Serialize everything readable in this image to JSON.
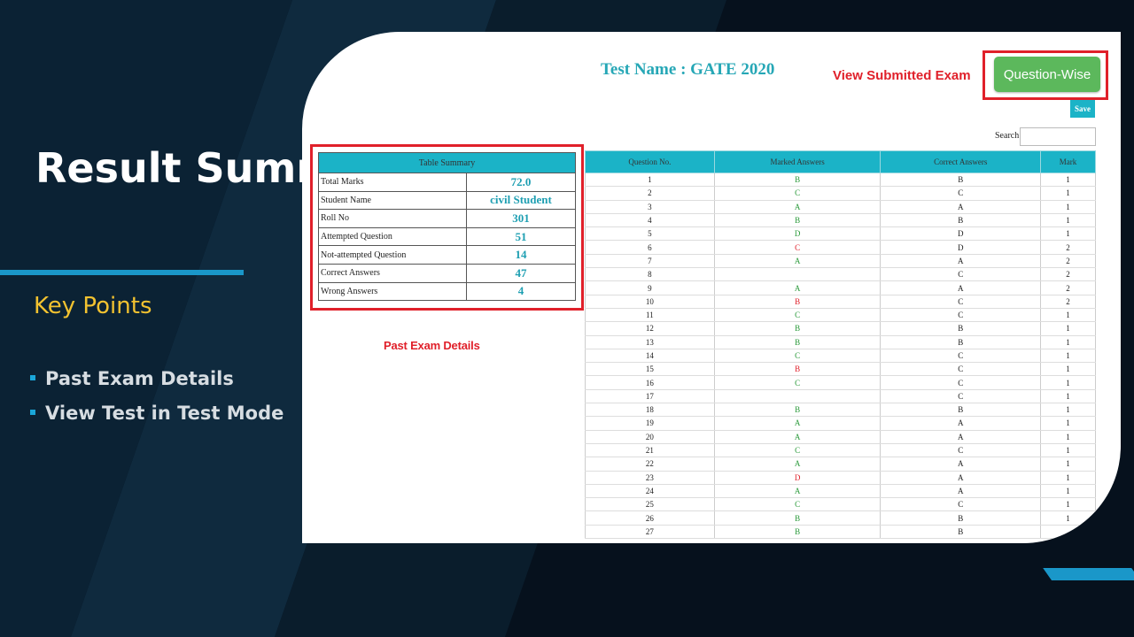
{
  "slide": {
    "title": "Result Summary",
    "subtitle": "Key Points",
    "bullets": [
      "Past Exam Details",
      "View Test in Test Mode"
    ]
  },
  "colors": {
    "background": "#06111d",
    "accent_blue": "#1a97c9",
    "subtitle_yellow": "#f2c230",
    "table_header": "#1bb3c7",
    "annotation_red": "#e0202a",
    "button_green": "#5cb85c"
  },
  "screenshot": {
    "test_name": "Test Name : GATE 2020",
    "annotation_view_submitted": "View Submitted Exam",
    "annotation_past_exam": "Past Exam Details",
    "question_wise_button": "Question-Wise",
    "save_button": "Save",
    "search_label": "Search:",
    "search_value": "",
    "summary_table": {
      "header": "Table Summary",
      "rows": [
        {
          "label": "Total Marks",
          "value": "72.0"
        },
        {
          "label": "Student Name",
          "value": "civil Student"
        },
        {
          "label": "Roll No",
          "value": "301"
        },
        {
          "label": "Attempted Question",
          "value": "51"
        },
        {
          "label": "Not-attempted Question",
          "value": "14"
        },
        {
          "label": "Correct Answers",
          "value": "47"
        },
        {
          "label": "Wrong Answers",
          "value": "4"
        }
      ]
    },
    "answers_table": {
      "columns": [
        "Question No.",
        "Marked Answers",
        "Correct Answers",
        "Mark"
      ],
      "rows": [
        {
          "q": "1",
          "marked": "B",
          "correct": "B",
          "mark": "1",
          "status": "correct"
        },
        {
          "q": "2",
          "marked": "C",
          "correct": "C",
          "mark": "1",
          "status": "correct"
        },
        {
          "q": "3",
          "marked": "A",
          "correct": "A",
          "mark": "1",
          "status": "correct"
        },
        {
          "q": "4",
          "marked": "B",
          "correct": "B",
          "mark": "1",
          "status": "correct"
        },
        {
          "q": "5",
          "marked": "D",
          "correct": "D",
          "mark": "1",
          "status": "correct"
        },
        {
          "q": "6",
          "marked": "C",
          "correct": "D",
          "mark": "2",
          "status": "wrong"
        },
        {
          "q": "7",
          "marked": "A",
          "correct": "A",
          "mark": "2",
          "status": "correct"
        },
        {
          "q": "8",
          "marked": "",
          "correct": "C",
          "mark": "2",
          "status": "none"
        },
        {
          "q": "9",
          "marked": "A",
          "correct": "A",
          "mark": "2",
          "status": "correct"
        },
        {
          "q": "10",
          "marked": "B",
          "correct": "C",
          "mark": "2",
          "status": "wrong"
        },
        {
          "q": "11",
          "marked": "C",
          "correct": "C",
          "mark": "1",
          "status": "correct"
        },
        {
          "q": "12",
          "marked": "B",
          "correct": "B",
          "mark": "1",
          "status": "correct"
        },
        {
          "q": "13",
          "marked": "B",
          "correct": "B",
          "mark": "1",
          "status": "correct"
        },
        {
          "q": "14",
          "marked": "C",
          "correct": "C",
          "mark": "1",
          "status": "correct"
        },
        {
          "q": "15",
          "marked": "B",
          "correct": "C",
          "mark": "1",
          "status": "wrong"
        },
        {
          "q": "16",
          "marked": "C",
          "correct": "C",
          "mark": "1",
          "status": "correct"
        },
        {
          "q": "17",
          "marked": "",
          "correct": "C",
          "mark": "1",
          "status": "none"
        },
        {
          "q": "18",
          "marked": "B",
          "correct": "B",
          "mark": "1",
          "status": "correct"
        },
        {
          "q": "19",
          "marked": "A",
          "correct": "A",
          "mark": "1",
          "status": "correct"
        },
        {
          "q": "20",
          "marked": "A",
          "correct": "A",
          "mark": "1",
          "status": "correct"
        },
        {
          "q": "21",
          "marked": "C",
          "correct": "C",
          "mark": "1",
          "status": "correct"
        },
        {
          "q": "22",
          "marked": "A",
          "correct": "A",
          "mark": "1",
          "status": "correct"
        },
        {
          "q": "23",
          "marked": "D",
          "correct": "A",
          "mark": "1",
          "status": "wrong"
        },
        {
          "q": "24",
          "marked": "A",
          "correct": "A",
          "mark": "1",
          "status": "correct"
        },
        {
          "q": "25",
          "marked": "C",
          "correct": "C",
          "mark": "1",
          "status": "correct"
        },
        {
          "q": "26",
          "marked": "B",
          "correct": "B",
          "mark": "1",
          "status": "correct"
        },
        {
          "q": "27",
          "marked": "B",
          "correct": "B",
          "mark": "",
          "status": "correct"
        }
      ]
    }
  }
}
